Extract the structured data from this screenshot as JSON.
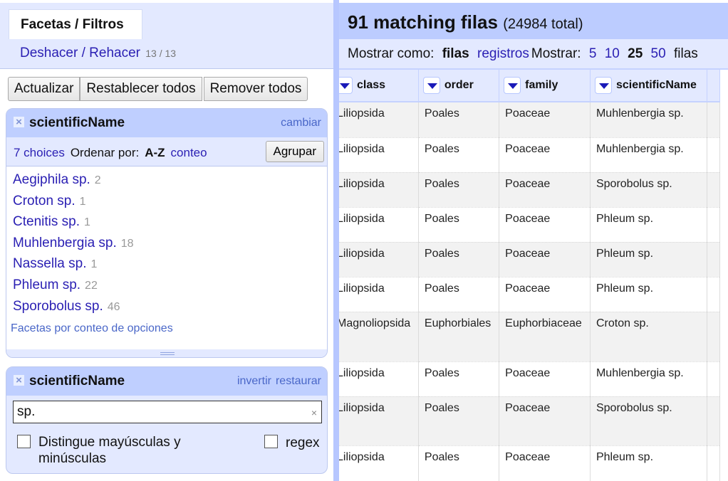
{
  "left_panel": {
    "tab_label": "Facetas / Filtros",
    "undo_redo_label": "Deshacer / Rehacer",
    "undo_redo_count": "13 / 13",
    "buttons": {
      "refresh": "Actualizar",
      "reset_all": "Restablecer todos",
      "remove_all": "Remover todos"
    },
    "list_facet": {
      "title": "scientificName",
      "change_link": "cambiar",
      "choices_count": "7 choices",
      "sort_label": "Ordenar por:",
      "sort_az": "A-Z",
      "sort_count": "conteo",
      "cluster_button": "Agrupar",
      "choices": [
        {
          "name": "Aegiphila sp.",
          "count": "2"
        },
        {
          "name": "Croton sp.",
          "count": "1"
        },
        {
          "name": "Ctenitis sp.",
          "count": "1"
        },
        {
          "name": "Muhlenbergia sp.",
          "count": "18"
        },
        {
          "name": "Nassella sp.",
          "count": "1"
        },
        {
          "name": "Phleum sp.",
          "count": "22"
        },
        {
          "name": "Sporobolus sp.",
          "count": "46"
        }
      ],
      "facet_by_count_link": "Facetas por conteo de opciones"
    },
    "text_facet": {
      "title": "scientificName",
      "invert_link": "invertir",
      "reset_link": "restaurar",
      "filter_value": "sp.",
      "clear_icon": "×",
      "case_sensitive_label_1": "Distingue mayúsculas y",
      "case_sensitive_label_2": "minúsculas",
      "regex_label": "regex",
      "close_icon": "×"
    }
  },
  "right_panel": {
    "matching_count": "91 matching filas",
    "total": "(24984 total)",
    "view_bar": {
      "show_as_label": "Mostrar como:",
      "rows_mode": "filas",
      "records_mode": "registros",
      "show_label": "Mostrar:",
      "page_sizes": [
        "5",
        "10",
        "25",
        "50"
      ],
      "page_size_selected": "25",
      "rows_suffix": "filas"
    },
    "columns": [
      "class",
      "order",
      "family",
      "scientificName"
    ],
    "rows": [
      [
        "Liliopsida",
        "Poales",
        "Poaceae",
        "Muhlenbergia sp."
      ],
      [
        "Liliopsida",
        "Poales",
        "Poaceae",
        "Muhlenbergia sp."
      ],
      [
        "Liliopsida",
        "Poales",
        "Poaceae",
        "Sporobolus sp."
      ],
      [
        "Liliopsida",
        "Poales",
        "Poaceae",
        "Phleum sp."
      ],
      [
        "Liliopsida",
        "Poales",
        "Poaceae",
        "Phleum sp."
      ],
      [
        "Liliopsida",
        "Poales",
        "Poaceae",
        "Phleum sp."
      ],
      [
        "Magnoliopsida",
        "Euphorbiales",
        "Euphorbiaceae",
        "Croton sp."
      ],
      [
        "Liliopsida",
        "Poales",
        "Poaceae",
        "Muhlenbergia sp."
      ],
      [
        "Liliopsida",
        "Poales",
        "Poaceae",
        "Sporobolus sp."
      ],
      [
        "Liliopsida",
        "Poales",
        "Poaceae",
        "Phleum sp."
      ]
    ]
  }
}
